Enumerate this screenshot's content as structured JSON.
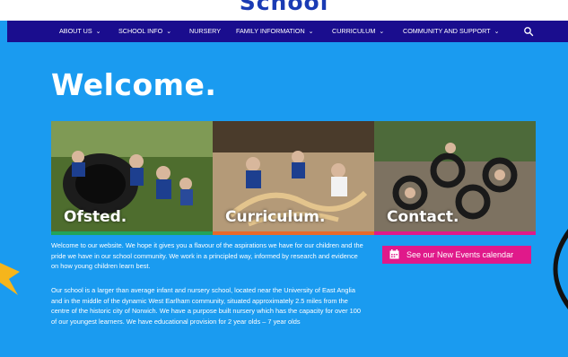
{
  "header": {
    "logo_text": "School"
  },
  "nav": {
    "items": [
      {
        "label": "ABOUT US",
        "dropdown": true
      },
      {
        "label": "SCHOOL INFO",
        "dropdown": true
      },
      {
        "label": "NURSERY",
        "dropdown": false
      },
      {
        "label": "FAMILY INFORMATION",
        "dropdown": true
      },
      {
        "label": "CURRICULUM",
        "dropdown": true
      },
      {
        "label": "COMMUNITY AND SUPPORT",
        "dropdown": true
      }
    ],
    "chevron": "⌄",
    "search_icon": "search-icon"
  },
  "main": {
    "heading": "Welcome.",
    "tiles": [
      {
        "label": "Ofsted.",
        "bar_color": "#22a35a"
      },
      {
        "label": "Curriculum.",
        "bar_color": "#e8692a"
      },
      {
        "label": "Contact.",
        "bar_color": "#e0198a"
      }
    ],
    "paragraph1": "Welcome to our website.  We hope it gives you a flavour of the aspirations we have for our children and the pride we have in our school community. We work in a principled way, informed by research and evidence on how young children learn best.",
    "paragraph2": "Our school is a larger than average infant and nursery school, located near the University of East Anglia and in the middle of the dynamic West Earlham community, situated approximately 2.5 miles from the centre of the historic city of Norwich. We have a purpose built nursery which has the capacity for over 100 of our youngest learners. We have educational provision for 2 year olds – 7 year olds",
    "events_button": "See our New Events calendar"
  },
  "colors": {
    "background": "#1a9bf0",
    "nav": "#1a0d8e",
    "accent_pink": "#e0198a",
    "logo": "#1a3bb4"
  }
}
